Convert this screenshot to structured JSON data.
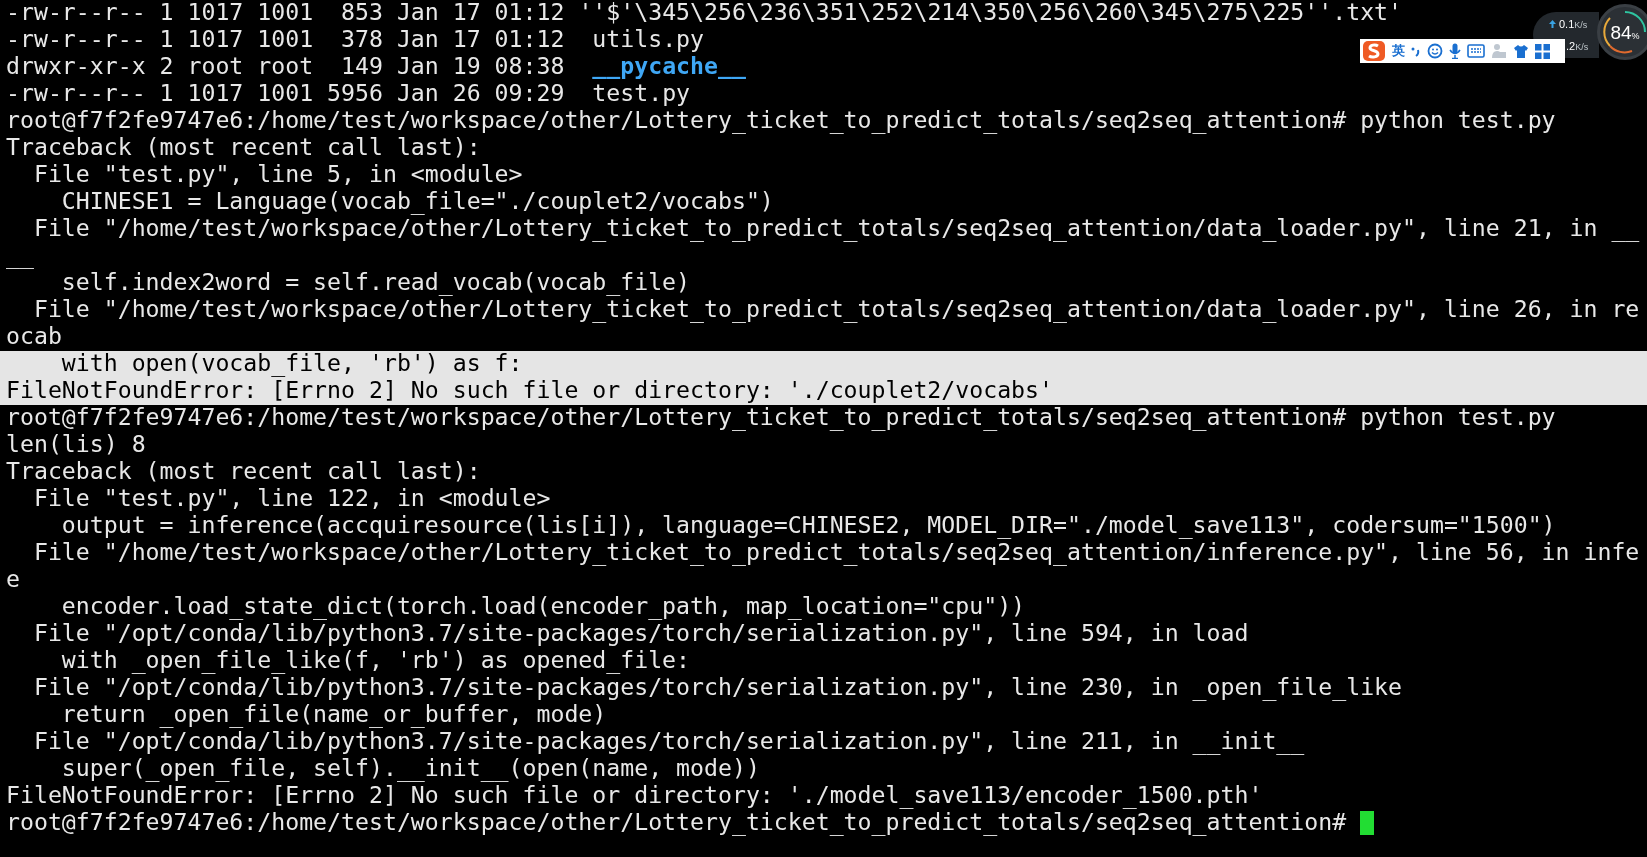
{
  "terminal": {
    "lines": [
      {
        "kind": "listing",
        "text": "-rw-r--r-- 1 1017 1001  853 Jan 17 01:12 ",
        "name": "''$'\\345\\256\\236\\351\\252\\214\\350\\256\\260\\345\\275\\225''.txt'",
        "is_directory": false,
        "selected": false
      },
      {
        "kind": "listing",
        "text": "-rw-r--r-- 1 1017 1001  378 Jan 17 01:12  ",
        "name": "utils.py",
        "is_directory": false,
        "selected": false
      },
      {
        "kind": "listing",
        "text": "drwxr-xr-x 2 root root  149 Jan 19 08:38  ",
        "name": "__pycache__",
        "is_directory": true,
        "selected": false
      },
      {
        "kind": "listing",
        "text": "-rw-r--r-- 1 1017 1001 5956 Jan 26 09:29  ",
        "name": "test.py",
        "is_directory": false,
        "selected": false
      },
      {
        "kind": "output",
        "text": "root@f7f2fe9747e6:/home/test/workspace/other/Lottery_ticket_to_predict_totals/seq2seq_attention# python test.py",
        "selected": false
      },
      {
        "kind": "output",
        "text": "Traceback (most recent call last):",
        "selected": false
      },
      {
        "kind": "output",
        "text": "  File \"test.py\", line 5, in <module>",
        "selected": false
      },
      {
        "kind": "output",
        "text": "    CHINESE1 = Language(vocab_file=\"./couplet2/vocabs\")",
        "selected": false
      },
      {
        "kind": "output",
        "text": "  File \"/home/test/workspace/other/Lottery_ticket_to_predict_totals/seq2seq_attention/data_loader.py\", line 21, in __",
        "selected": false
      },
      {
        "kind": "output",
        "text": "__",
        "selected": false
      },
      {
        "kind": "output",
        "text": "    self.index2word = self.read_vocab(vocab_file)",
        "selected": false
      },
      {
        "kind": "output",
        "text": "  File \"/home/test/workspace/other/Lottery_ticket_to_predict_totals/seq2seq_attention/data_loader.py\", line 26, in re",
        "selected": false
      },
      {
        "kind": "output",
        "text": "ocab",
        "selected": false
      },
      {
        "kind": "output",
        "text": "    with open(vocab_file, 'rb') as f:",
        "selected": true
      },
      {
        "kind": "output",
        "text": "FileNotFoundError: [Errno 2] No such file or directory: './couplet2/vocabs'",
        "selected": true
      },
      {
        "kind": "output",
        "text": "root@f7f2fe9747e6:/home/test/workspace/other/Lottery_ticket_to_predict_totals/seq2seq_attention# python test.py",
        "selected": false
      },
      {
        "kind": "output",
        "text": "len(lis) 8",
        "selected": false
      },
      {
        "kind": "output",
        "text": "Traceback (most recent call last):",
        "selected": false
      },
      {
        "kind": "output",
        "text": "  File \"test.py\", line 122, in <module>",
        "selected": false
      },
      {
        "kind": "output",
        "text": "    output = inference(accquiresource(lis[i]), language=CHINESE2, MODEL_DIR=\"./model_save113\", codersum=\"1500\")",
        "selected": false
      },
      {
        "kind": "output",
        "text": "  File \"/home/test/workspace/other/Lottery_ticket_to_predict_totals/seq2seq_attention/inference.py\", line 56, in infe",
        "selected": false
      },
      {
        "kind": "output",
        "text": "e",
        "selected": false
      },
      {
        "kind": "output",
        "text": "    encoder.load_state_dict(torch.load(encoder_path, map_location=\"cpu\"))",
        "selected": false
      },
      {
        "kind": "output",
        "text": "  File \"/opt/conda/lib/python3.7/site-packages/torch/serialization.py\", line 594, in load",
        "selected": false
      },
      {
        "kind": "output",
        "text": "    with _open_file_like(f, 'rb') as opened_file:",
        "selected": false
      },
      {
        "kind": "output",
        "text": "  File \"/opt/conda/lib/python3.7/site-packages/torch/serialization.py\", line 230, in _open_file_like",
        "selected": false
      },
      {
        "kind": "output",
        "text": "    return _open_file(name_or_buffer, mode)",
        "selected": false
      },
      {
        "kind": "output",
        "text": "  File \"/opt/conda/lib/python3.7/site-packages/torch/serialization.py\", line 211, in __init__",
        "selected": false
      },
      {
        "kind": "output",
        "text": "    super(_open_file, self).__init__(open(name, mode))",
        "selected": false
      },
      {
        "kind": "output",
        "text": "FileNotFoundError: [Errno 2] No such file or directory: './model_save113/encoder_1500.pth'",
        "selected": false
      },
      {
        "kind": "output",
        "text": "root@f7f2fe9747e6:/home/test/workspace/other/Lottery_ticket_to_predict_totals/seq2seq_attention# ",
        "selected": false
      }
    ],
    "cursor_visible": true
  },
  "network_widget": {
    "upload": "0.1",
    "upload_unit": "K/s",
    "download": ".2",
    "download_unit": "K/s",
    "usage": "84",
    "usage_unit": "%"
  },
  "ime_toolbar": {
    "mode": "英"
  }
}
